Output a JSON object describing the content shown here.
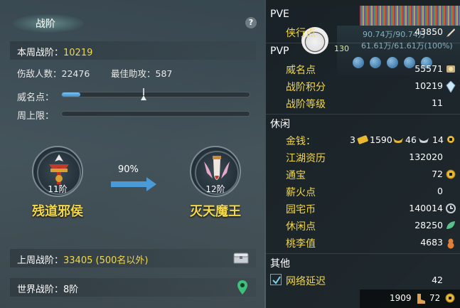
{
  "left": {
    "title": "战阶",
    "help": "?",
    "weekly_label": "本周战阶：",
    "weekly_value": "10219",
    "kill_label": "伤敌人数：",
    "kill_value": "22476",
    "assist_label": "最佳助攻：",
    "assist_value": "587",
    "prestige_label": "威名点：",
    "prestige_fill": 0.1,
    "prestige_marker": 0.43,
    "weekly_cap_label": "周上限：",
    "weekly_cap_fill": 0,
    "current_rank": {
      "level": "11阶",
      "name": "残道邪侯"
    },
    "next_rank": {
      "level": "12阶",
      "name": "灭天魔王"
    },
    "progress_pct": "90%",
    "last_week_label": "上周战阶：",
    "last_week_value": "33405 (500名以外)",
    "world_label": "世界战阶：",
    "world_value": "8阶"
  },
  "right": {
    "hud": {
      "line1": "90.74万/90.74万",
      "line2": "61.61万/61.61万(100%)",
      "level_num": "130"
    },
    "pve_header": "PVE",
    "pve_items": [
      {
        "label": "侠行点",
        "value": "43850",
        "icon": "quill-icon"
      }
    ],
    "pvp_header": "PVP",
    "pvp_items": [
      {
        "label": "威名点",
        "value": "55571",
        "icon": "prestige-icon"
      },
      {
        "label": "战阶积分",
        "value": "10219",
        "icon": "crystal-icon"
      },
      {
        "label": "战阶等级",
        "value": "11",
        "icon": ""
      }
    ],
    "leisure_header": "休闲",
    "gold": {
      "label": "金钱：",
      "gold": "3",
      "silver": "1590",
      "copper": "46",
      "coin": "14"
    },
    "leisure_items": [
      {
        "label": "江湖资历",
        "value": "132020",
        "icon": ""
      },
      {
        "label": "通宝",
        "value": "72",
        "icon": "coin-icon"
      },
      {
        "label": "薪火点",
        "value": "0",
        "icon": ""
      },
      {
        "label": "园宅币",
        "value": "140014",
        "icon": "home-coin-icon"
      },
      {
        "label": "休闲点",
        "value": "28250",
        "icon": "leaf-icon"
      },
      {
        "label": "桃李值",
        "value": "4683",
        "icon": "gourd-icon"
      }
    ],
    "other_header": "其他",
    "other_items": [
      {
        "label": "网络延迟",
        "value": "42",
        "checked": true
      }
    ],
    "bottom": {
      "count": "1909",
      "coins": "72"
    }
  },
  "colors": {
    "accent_yellow": "#f2d84a",
    "bar_blue": "#3d8fd0",
    "panel_dark": "#121a1e"
  }
}
